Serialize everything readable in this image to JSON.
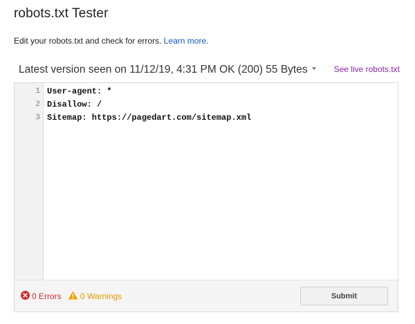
{
  "page": {
    "title": "robots.txt Tester",
    "intro_text": "Edit your robots.txt and check for errors.",
    "learn_more_label": "Learn more."
  },
  "version": {
    "label": "Latest version seen on 11/12/19, 4:31 PM OK (200) 55 Bytes",
    "live_link_label": "See live robots.txt"
  },
  "editor": {
    "lines": [
      {
        "number": "1",
        "text": "User-agent: *"
      },
      {
        "number": "2",
        "text": "Disallow: /"
      },
      {
        "number": "3",
        "text": "Sitemap: https://pagedart.com/sitemap.xml"
      }
    ]
  },
  "status": {
    "errors_label": "0 Errors",
    "warnings_label": "0 Warnings",
    "error_color": "#d32f2f",
    "warning_color": "#f4a100",
    "error_icon": "error-circle-icon",
    "warning_icon": "warning-triangle-icon"
  },
  "actions": {
    "submit_label": "Submit"
  },
  "colors": {
    "link": "#1155cc",
    "live_link": "#8e24aa"
  }
}
